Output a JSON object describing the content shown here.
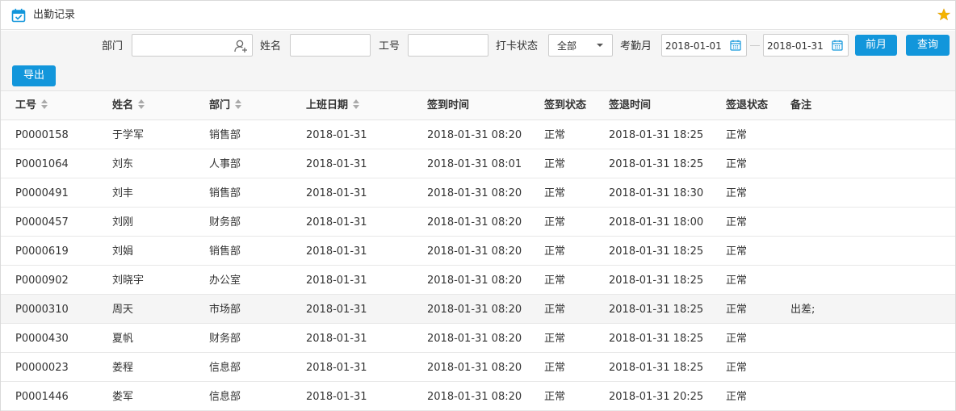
{
  "window": {
    "title": "出勤记录",
    "icon": "calendar-check-icon",
    "favorite_icon": "star-icon",
    "accent_color": "#1296db",
    "star_color": "#f5b400"
  },
  "filters": {
    "department_label": "部门",
    "department_value": "",
    "name_label": "姓名",
    "name_value": "",
    "employee_id_label": "工号",
    "employee_id_value": "",
    "punch_status_label": "打卡状态",
    "punch_status_value": "全部",
    "attendance_month_label": "考勤月",
    "date_from": "2018-01-01",
    "date_to": "2018-01-31",
    "prev_month_button": "前月",
    "query_button": "查询"
  },
  "toolbar": {
    "export_button": "导出"
  },
  "table": {
    "columns": [
      "工号",
      "姓名",
      "部门",
      "上班日期",
      "签到时间",
      "签到状态",
      "签退时间",
      "签退状态",
      "备注"
    ],
    "sortable": [
      true,
      true,
      true,
      true,
      false,
      false,
      false,
      false,
      false
    ],
    "rows": [
      [
        "P0000158",
        "于学军",
        "销售部",
        "2018-01-31",
        "2018-01-31 08:20",
        "正常",
        "2018-01-31 18:25",
        "正常",
        ""
      ],
      [
        "P0001064",
        "刘东",
        "人事部",
        "2018-01-31",
        "2018-01-31 08:01",
        "正常",
        "2018-01-31 18:25",
        "正常",
        ""
      ],
      [
        "P0000491",
        "刘丰",
        "销售部",
        "2018-01-31",
        "2018-01-31 08:20",
        "正常",
        "2018-01-31 18:30",
        "正常",
        ""
      ],
      [
        "P0000457",
        "刘刚",
        "财务部",
        "2018-01-31",
        "2018-01-31 08:20",
        "正常",
        "2018-01-31 18:00",
        "正常",
        ""
      ],
      [
        "P0000619",
        "刘娟",
        "销售部",
        "2018-01-31",
        "2018-01-31 08:20",
        "正常",
        "2018-01-31 18:25",
        "正常",
        ""
      ],
      [
        "P0000902",
        "刘晓宇",
        "办公室",
        "2018-01-31",
        "2018-01-31 08:20",
        "正常",
        "2018-01-31 18:25",
        "正常",
        ""
      ],
      [
        "P0000310",
        "周天",
        "市场部",
        "2018-01-31",
        "2018-01-31 08:20",
        "正常",
        "2018-01-31 18:25",
        "正常",
        "出差;"
      ],
      [
        "P0000430",
        "夏帆",
        "财务部",
        "2018-01-31",
        "2018-01-31 08:20",
        "正常",
        "2018-01-31 18:25",
        "正常",
        ""
      ],
      [
        "P0000023",
        "姜程",
        "信息部",
        "2018-01-31",
        "2018-01-31 08:20",
        "正常",
        "2018-01-31 18:25",
        "正常",
        ""
      ],
      [
        "P0001446",
        "娄军",
        "信息部",
        "2018-01-31",
        "2018-01-31 08:20",
        "正常",
        "2018-01-31 20:25",
        "正常",
        ""
      ]
    ],
    "highlighted_row": 6
  }
}
